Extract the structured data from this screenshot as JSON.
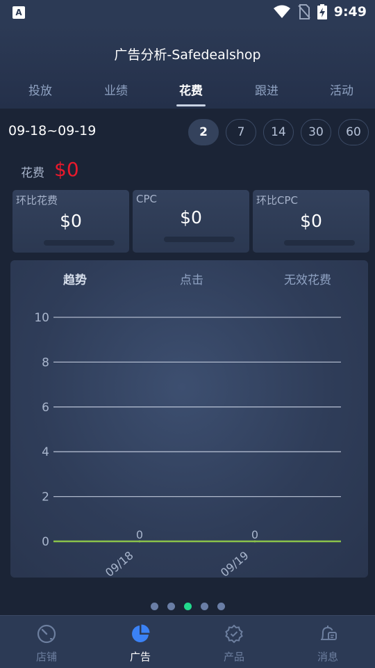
{
  "status_bar": {
    "time": "9:49",
    "left_icon_letter": "A"
  },
  "header": {
    "title": "广告分析-Safedealshop"
  },
  "tabs": [
    {
      "label": "投放",
      "active": false
    },
    {
      "label": "业绩",
      "active": false
    },
    {
      "label": "花费",
      "active": true
    },
    {
      "label": "跟进",
      "active": false
    },
    {
      "label": "活动",
      "active": false
    }
  ],
  "date_range": "09-18~09-19",
  "range_options": [
    {
      "label": "2",
      "active": true
    },
    {
      "label": "7",
      "active": false
    },
    {
      "label": "14",
      "active": false
    },
    {
      "label": "30",
      "active": false
    },
    {
      "label": "60",
      "active": false
    }
  ],
  "spend": {
    "label": "花费",
    "value": "$0"
  },
  "cards": [
    {
      "label": "环比花费",
      "value": "$0"
    },
    {
      "label": "CPC",
      "value": "$0"
    },
    {
      "label": "环比CPC",
      "value": "$0"
    }
  ],
  "chart_tabs": [
    {
      "label": "趋势",
      "active": true
    },
    {
      "label": "点击",
      "active": false
    },
    {
      "label": "无效花费",
      "active": false
    }
  ],
  "chart_data": {
    "type": "line",
    "x": [
      "09/18",
      "09/19"
    ],
    "series": [
      {
        "values": [
          0,
          0
        ],
        "color": "#8bc34a"
      }
    ],
    "data_labels": [
      "0",
      "0"
    ],
    "ylim": [
      0,
      10
    ],
    "yticks": [
      "0",
      "2",
      "4",
      "6",
      "8",
      "10"
    ],
    "grid": true,
    "title": "",
    "xlabel": "",
    "ylabel": ""
  },
  "pager": {
    "count": 5,
    "active_index": 2
  },
  "bottom_nav": [
    {
      "label": "店铺",
      "icon": "speedometer-icon",
      "active": false
    },
    {
      "label": "广告",
      "icon": "pie-chart-icon",
      "active": true
    },
    {
      "label": "产品",
      "icon": "badge-check-icon",
      "active": false
    },
    {
      "label": "消息",
      "icon": "bell-icon",
      "active": false
    }
  ],
  "colors": {
    "accent_blue": "#3b82f6",
    "spend_red": "#e8192c",
    "pager_active": "#22d98c",
    "line_green": "#8bc34a"
  }
}
